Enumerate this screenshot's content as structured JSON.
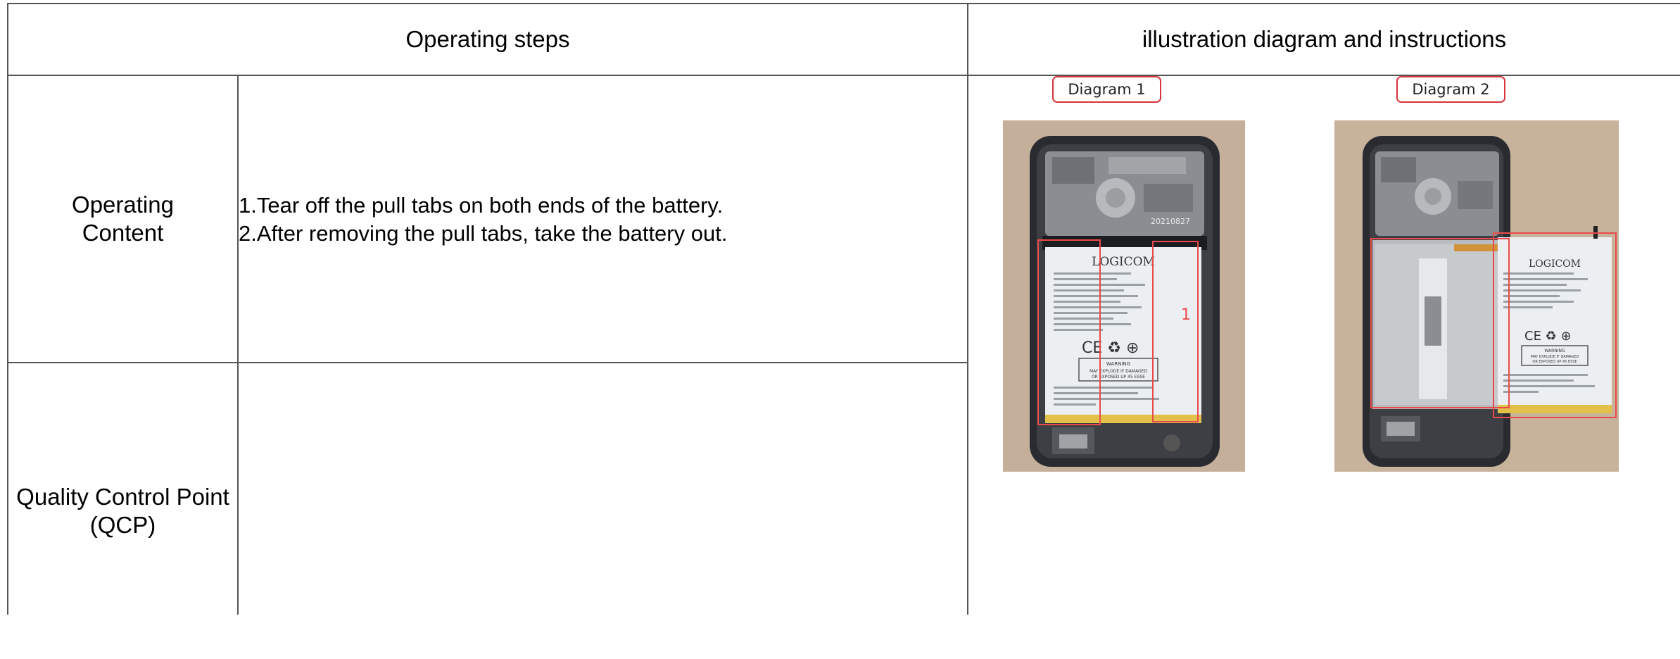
{
  "table": {
    "header_left": "Operating steps",
    "header_right": "illustration diagram and instructions",
    "row_content_label": "Operating Content",
    "row_qcp_label": "Quality Control Point (QCP)",
    "content_lines": [
      "1.Tear off the pull tabs on both ends of the battery.",
      "2.After removing the pull tabs, take the battery out."
    ],
    "qcp_text": ""
  },
  "diagrams": [
    {
      "label": "Diagram 1",
      "battery_brand": "LOGICOM",
      "date_code": "20210827",
      "marker": "1",
      "warning_title": "WARNING",
      "warning_lines": [
        "MAY EXPLODE IF DAMAGED",
        "OR EXPOSED UP 45 ESSE"
      ]
    },
    {
      "label": "Diagram 2",
      "battery_brand": "LOGICOM",
      "warning_title": "WARNING",
      "warning_lines": [
        "MAY EXPLODE IF DAMAGED",
        "OR EXPOSED UP 45 ESSE"
      ]
    }
  ],
  "colors": {
    "grid_line": "#555555",
    "label_border": "#d8343c",
    "highlight_box": "#ec4a4a",
    "phone_frame": "#2a2b30",
    "battery_body": "#eceff1",
    "background_surface": "#c9b59f"
  }
}
